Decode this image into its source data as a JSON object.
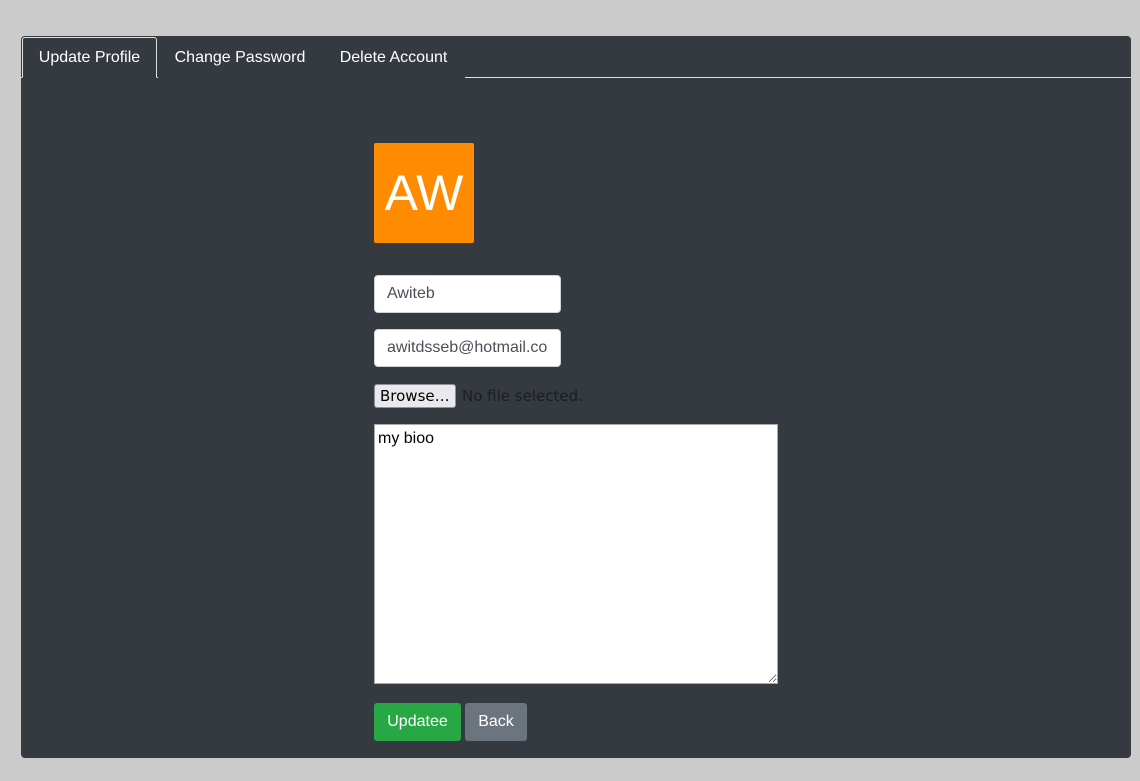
{
  "tabs": [
    {
      "label": "Update Profile",
      "active": true
    },
    {
      "label": "Change Password",
      "active": false
    },
    {
      "label": "Delete Account",
      "active": false
    }
  ],
  "profile": {
    "avatar_initials": "AW",
    "avatar_color": "#ff8c00",
    "name_value": "Awiteb",
    "email_value": "awitdsseb@hotmail.co",
    "file_button_label": "Browse…",
    "file_status": "No file selected.",
    "bio_value": "my bioo"
  },
  "actions": {
    "update_label": "Updatee",
    "back_label": "Back",
    "update_color": "#28a745",
    "back_color": "#6c757d"
  }
}
